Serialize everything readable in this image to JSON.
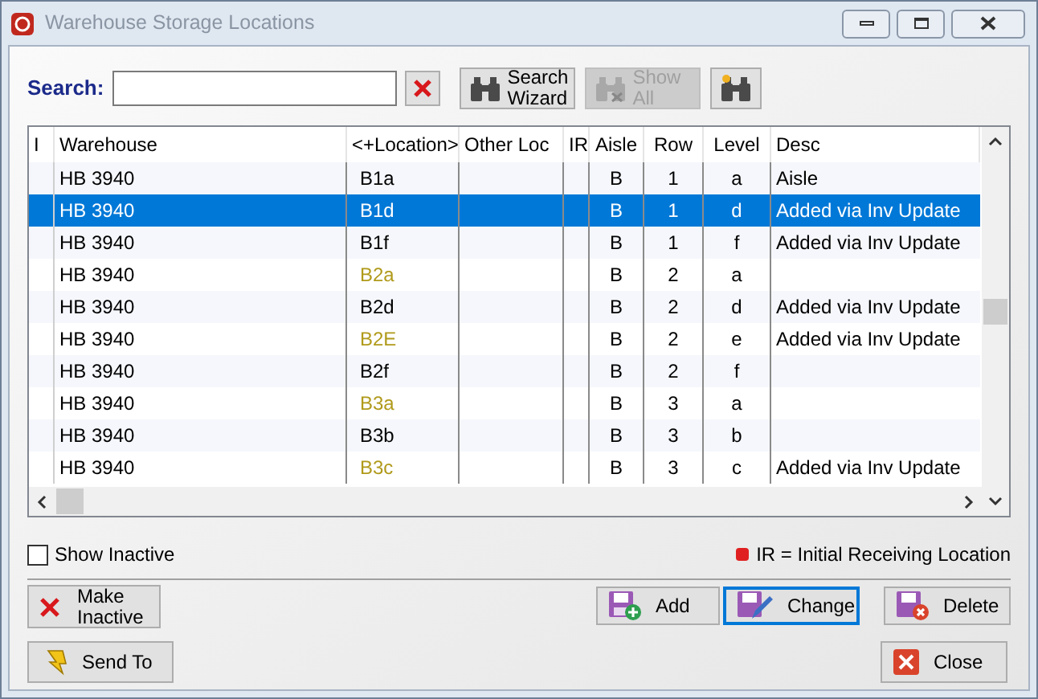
{
  "window": {
    "title": "Warehouse Storage Locations"
  },
  "search": {
    "label": "Search:"
  },
  "toolbar": [
    {
      "kind": "wizard",
      "label": "Search Wizard",
      "disabled": false
    },
    {
      "kind": "show_all",
      "label": "Show All",
      "disabled": true
    },
    {
      "kind": "new",
      "disabled": false
    }
  ],
  "table": {
    "columns": [
      "I",
      "Warehouse",
      "<+Location>",
      "Other Loc",
      "IR",
      "Aisle",
      "Row",
      "Level",
      "Desc"
    ],
    "rows": [
      {
        "warehouse": "HB 3940",
        "location": "B1a",
        "aisle": "B",
        "row": "1",
        "level": "a",
        "desc": "Aisle",
        "selected": false,
        "highlighted": false
      },
      {
        "warehouse": "HB 3940",
        "location": "B1d",
        "aisle": "B",
        "row": "1",
        "level": "d",
        "desc": "Added via Inv Update",
        "selected": true,
        "highlighted": false
      },
      {
        "warehouse": "HB 3940",
        "location": "B1f",
        "aisle": "B",
        "row": "1",
        "level": "f",
        "desc": "Added via Inv Update",
        "selected": false,
        "highlighted": false
      },
      {
        "warehouse": "HB 3940",
        "location": "B2a",
        "aisle": "B",
        "row": "2",
        "level": "a",
        "selected": false,
        "highlighted": true
      },
      {
        "warehouse": "HB 3940",
        "location": "B2d",
        "aisle": "B",
        "row": "2",
        "level": "d",
        "desc": "Added via Inv Update",
        "selected": false,
        "highlighted": false
      },
      {
        "warehouse": "HB 3940",
        "location": "B2E",
        "aisle": "B",
        "row": "2",
        "level": "e",
        "desc": "Added via Inv Update",
        "selected": false,
        "highlighted": true
      },
      {
        "warehouse": "HB 3940",
        "location": "B2f",
        "aisle": "B",
        "row": "2",
        "level": "f",
        "selected": false,
        "highlighted": false
      },
      {
        "warehouse": "HB 3940",
        "location": "B3a",
        "aisle": "B",
        "row": "3",
        "level": "a",
        "selected": false,
        "highlighted": true
      },
      {
        "warehouse": "HB 3940",
        "location": "B3b",
        "aisle": "B",
        "row": "3",
        "level": "b",
        "selected": false,
        "highlighted": false
      },
      {
        "warehouse": "HB 3940",
        "location": "B3c",
        "aisle": "B",
        "row": "3",
        "level": "c",
        "desc": "Added via Inv Update",
        "selected": false,
        "highlighted": true
      }
    ]
  },
  "show_inactive": {
    "label": "Show Inactive",
    "checked": false
  },
  "legend": {
    "label": "IR = Initial Receiving Location",
    "color": "#e02020"
  },
  "buttons": [
    {
      "kind": "make_inactive",
      "label": "Make Inactive",
      "focused": false
    },
    {
      "kind": "add",
      "label": "Add",
      "focused": false
    },
    {
      "kind": "change",
      "label": "Change",
      "focused": true
    },
    {
      "kind": "delete",
      "label": "Delete",
      "focused": false
    },
    {
      "kind": "send_to",
      "label": "Send To",
      "focused": false
    },
    {
      "kind": "close",
      "label": "Close",
      "focused": false
    }
  ]
}
